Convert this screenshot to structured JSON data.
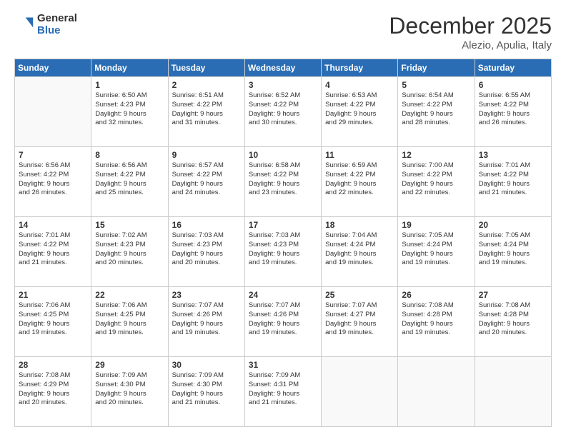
{
  "logo": {
    "general": "General",
    "blue": "Blue"
  },
  "header": {
    "month": "December 2025",
    "location": "Alezio, Apulia, Italy"
  },
  "weekdays": [
    "Sunday",
    "Monday",
    "Tuesday",
    "Wednesday",
    "Thursday",
    "Friday",
    "Saturday"
  ],
  "weeks": [
    [
      {
        "day": "",
        "info": ""
      },
      {
        "day": "1",
        "info": "Sunrise: 6:50 AM\nSunset: 4:23 PM\nDaylight: 9 hours\nand 32 minutes."
      },
      {
        "day": "2",
        "info": "Sunrise: 6:51 AM\nSunset: 4:22 PM\nDaylight: 9 hours\nand 31 minutes."
      },
      {
        "day": "3",
        "info": "Sunrise: 6:52 AM\nSunset: 4:22 PM\nDaylight: 9 hours\nand 30 minutes."
      },
      {
        "day": "4",
        "info": "Sunrise: 6:53 AM\nSunset: 4:22 PM\nDaylight: 9 hours\nand 29 minutes."
      },
      {
        "day": "5",
        "info": "Sunrise: 6:54 AM\nSunset: 4:22 PM\nDaylight: 9 hours\nand 28 minutes."
      },
      {
        "day": "6",
        "info": "Sunrise: 6:55 AM\nSunset: 4:22 PM\nDaylight: 9 hours\nand 26 minutes."
      }
    ],
    [
      {
        "day": "7",
        "info": "Sunrise: 6:56 AM\nSunset: 4:22 PM\nDaylight: 9 hours\nand 26 minutes."
      },
      {
        "day": "8",
        "info": "Sunrise: 6:56 AM\nSunset: 4:22 PM\nDaylight: 9 hours\nand 25 minutes."
      },
      {
        "day": "9",
        "info": "Sunrise: 6:57 AM\nSunset: 4:22 PM\nDaylight: 9 hours\nand 24 minutes."
      },
      {
        "day": "10",
        "info": "Sunrise: 6:58 AM\nSunset: 4:22 PM\nDaylight: 9 hours\nand 23 minutes."
      },
      {
        "day": "11",
        "info": "Sunrise: 6:59 AM\nSunset: 4:22 PM\nDaylight: 9 hours\nand 22 minutes."
      },
      {
        "day": "12",
        "info": "Sunrise: 7:00 AM\nSunset: 4:22 PM\nDaylight: 9 hours\nand 22 minutes."
      },
      {
        "day": "13",
        "info": "Sunrise: 7:01 AM\nSunset: 4:22 PM\nDaylight: 9 hours\nand 21 minutes."
      }
    ],
    [
      {
        "day": "14",
        "info": "Sunrise: 7:01 AM\nSunset: 4:22 PM\nDaylight: 9 hours\nand 21 minutes."
      },
      {
        "day": "15",
        "info": "Sunrise: 7:02 AM\nSunset: 4:23 PM\nDaylight: 9 hours\nand 20 minutes."
      },
      {
        "day": "16",
        "info": "Sunrise: 7:03 AM\nSunset: 4:23 PM\nDaylight: 9 hours\nand 20 minutes."
      },
      {
        "day": "17",
        "info": "Sunrise: 7:03 AM\nSunset: 4:23 PM\nDaylight: 9 hours\nand 19 minutes."
      },
      {
        "day": "18",
        "info": "Sunrise: 7:04 AM\nSunset: 4:24 PM\nDaylight: 9 hours\nand 19 minutes."
      },
      {
        "day": "19",
        "info": "Sunrise: 7:05 AM\nSunset: 4:24 PM\nDaylight: 9 hours\nand 19 minutes."
      },
      {
        "day": "20",
        "info": "Sunrise: 7:05 AM\nSunset: 4:24 PM\nDaylight: 9 hours\nand 19 minutes."
      }
    ],
    [
      {
        "day": "21",
        "info": "Sunrise: 7:06 AM\nSunset: 4:25 PM\nDaylight: 9 hours\nand 19 minutes."
      },
      {
        "day": "22",
        "info": "Sunrise: 7:06 AM\nSunset: 4:25 PM\nDaylight: 9 hours\nand 19 minutes."
      },
      {
        "day": "23",
        "info": "Sunrise: 7:07 AM\nSunset: 4:26 PM\nDaylight: 9 hours\nand 19 minutes."
      },
      {
        "day": "24",
        "info": "Sunrise: 7:07 AM\nSunset: 4:26 PM\nDaylight: 9 hours\nand 19 minutes."
      },
      {
        "day": "25",
        "info": "Sunrise: 7:07 AM\nSunset: 4:27 PM\nDaylight: 9 hours\nand 19 minutes."
      },
      {
        "day": "26",
        "info": "Sunrise: 7:08 AM\nSunset: 4:28 PM\nDaylight: 9 hours\nand 19 minutes."
      },
      {
        "day": "27",
        "info": "Sunrise: 7:08 AM\nSunset: 4:28 PM\nDaylight: 9 hours\nand 20 minutes."
      }
    ],
    [
      {
        "day": "28",
        "info": "Sunrise: 7:08 AM\nSunset: 4:29 PM\nDaylight: 9 hours\nand 20 minutes."
      },
      {
        "day": "29",
        "info": "Sunrise: 7:09 AM\nSunset: 4:30 PM\nDaylight: 9 hours\nand 20 minutes."
      },
      {
        "day": "30",
        "info": "Sunrise: 7:09 AM\nSunset: 4:30 PM\nDaylight: 9 hours\nand 21 minutes."
      },
      {
        "day": "31",
        "info": "Sunrise: 7:09 AM\nSunset: 4:31 PM\nDaylight: 9 hours\nand 21 minutes."
      },
      {
        "day": "",
        "info": ""
      },
      {
        "day": "",
        "info": ""
      },
      {
        "day": "",
        "info": ""
      }
    ]
  ]
}
